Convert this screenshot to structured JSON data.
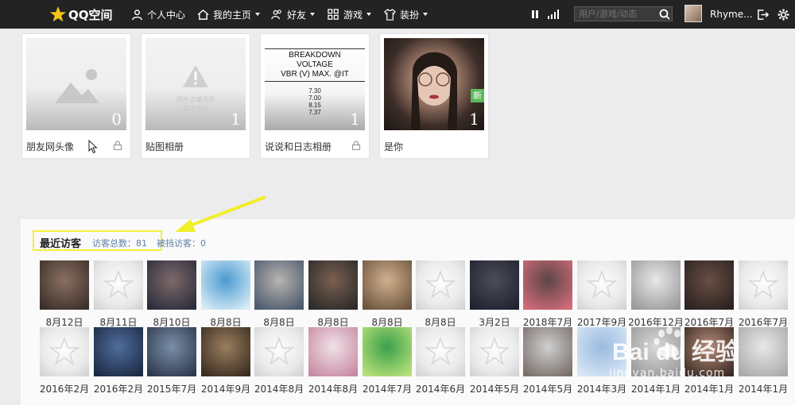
{
  "nav": {
    "logo": "QQ空间",
    "personal_center": "个人中心",
    "my_home": "我的主页",
    "friends": "好友",
    "games": "游戏",
    "dress": "装扮",
    "search_placeholder": "用户/游戏/动态",
    "username": "Rhyme..."
  },
  "albums": [
    {
      "name": "朋友网头像",
      "count": "0"
    },
    {
      "name": "贴图相册",
      "count": "1",
      "overlay": "图片涉嫌违规\n禁止访问"
    },
    {
      "name": "说说和日志相册",
      "count": "1",
      "lines": [
        "BREAKDOWN",
        "VOLTAGE",
        "VBR (V) MAX. @IT",
        "7.30",
        "7.00",
        "8.15",
        "7.37"
      ]
    },
    {
      "name": "是你",
      "count": "1",
      "badge": "新"
    }
  ],
  "visitors": {
    "title": "最近访客",
    "total": "访客总数：81",
    "blocked": "被挡访客：0",
    "row1": [
      "8月12日",
      "8月11日",
      "8月10日",
      "8月8日",
      "8月8日",
      "8月8日",
      "8月8日",
      "8月8日",
      "3月2日",
      "2018年7月",
      "2017年9月",
      "2016年12月",
      "2016年7月",
      "2016年7月"
    ],
    "row2": [
      "2016年2月",
      "2016年2月",
      "2015年7月",
      "2014年9月",
      "2014年8月",
      "2014年8月",
      "2014年7月",
      "2014年6月",
      "2014年5月",
      "2014年5月",
      "2014年3月",
      "2014年1月",
      "2014年1月",
      "2014年1月"
    ]
  },
  "watermark": {
    "brand": "Bai du 经验",
    "url": "jingyan.baidu.com"
  },
  "colors": {
    "topbar": "#232323",
    "highlight": "#f2f03a",
    "link": "#5b7da6",
    "badge": "#5cb85c"
  }
}
